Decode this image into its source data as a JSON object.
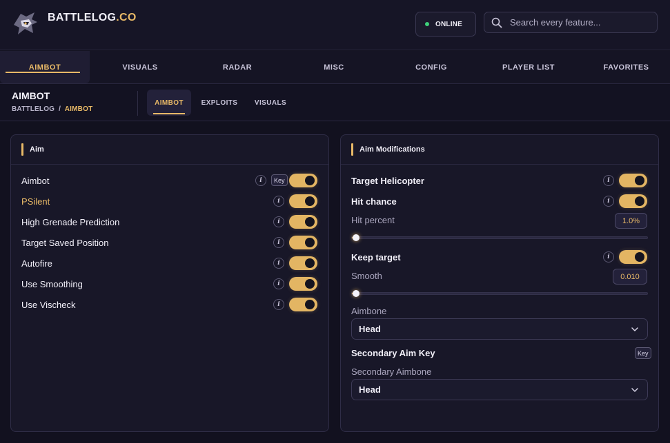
{
  "brand": {
    "name": "BATTLELOG",
    "suffix": ".CO"
  },
  "status": {
    "label": "ONLINE",
    "color": "#3ed07a"
  },
  "search": {
    "placeholder": "Search every feature..."
  },
  "nav": {
    "tabs": [
      "AIMBOT",
      "VISUALS",
      "RADAR",
      "MISC",
      "CONFIG",
      "PLAYER LIST",
      "FAVORITES"
    ],
    "active": "AIMBOT"
  },
  "page": {
    "title": "AIMBOT",
    "breadcrumb_root": "BATTLELOG",
    "breadcrumb_sep": "/",
    "breadcrumb_current": "AIMBOT"
  },
  "subtabs": {
    "items": [
      "AIMBOT",
      "EXPLOITS",
      "VISUALS"
    ],
    "active": "AIMBOT"
  },
  "colors": {
    "accent": "#e8b967",
    "background": "#12111f",
    "panel": "#181728"
  },
  "aim_panel": {
    "title": "Aim",
    "rows": [
      {
        "label": "Aimbot",
        "key": "Key",
        "enabled": true
      },
      {
        "label": "PSilent",
        "enabled": true
      },
      {
        "label": "High Grenade Prediction",
        "enabled": true
      },
      {
        "label": "Target Saved Position",
        "enabled": true
      },
      {
        "label": "Autofire",
        "enabled": true
      },
      {
        "label": "Use Smoothing",
        "enabled": true
      },
      {
        "label": "Use Vischeck",
        "enabled": true
      }
    ]
  },
  "mods_panel": {
    "title": "Aim Modifications",
    "target_helicopter": {
      "label": "Target Helicopter",
      "enabled": true
    },
    "hit_chance": {
      "label": "Hit chance",
      "enabled": true
    },
    "hit_percent": {
      "label": "Hit percent",
      "value": "1.0%",
      "fraction": 0.01
    },
    "keep_target": {
      "label": "Keep target",
      "enabled": true
    },
    "smooth": {
      "label": "Smooth",
      "value": "0.010",
      "fraction": 0.01
    },
    "aimbone": {
      "label": "Aimbone",
      "value": "Head"
    },
    "secondary_key": {
      "label": "Secondary Aim Key",
      "key": "Key"
    },
    "secondary_aimbone": {
      "label": "Secondary Aimbone",
      "value": "Head"
    },
    "info_glyph": "i"
  }
}
